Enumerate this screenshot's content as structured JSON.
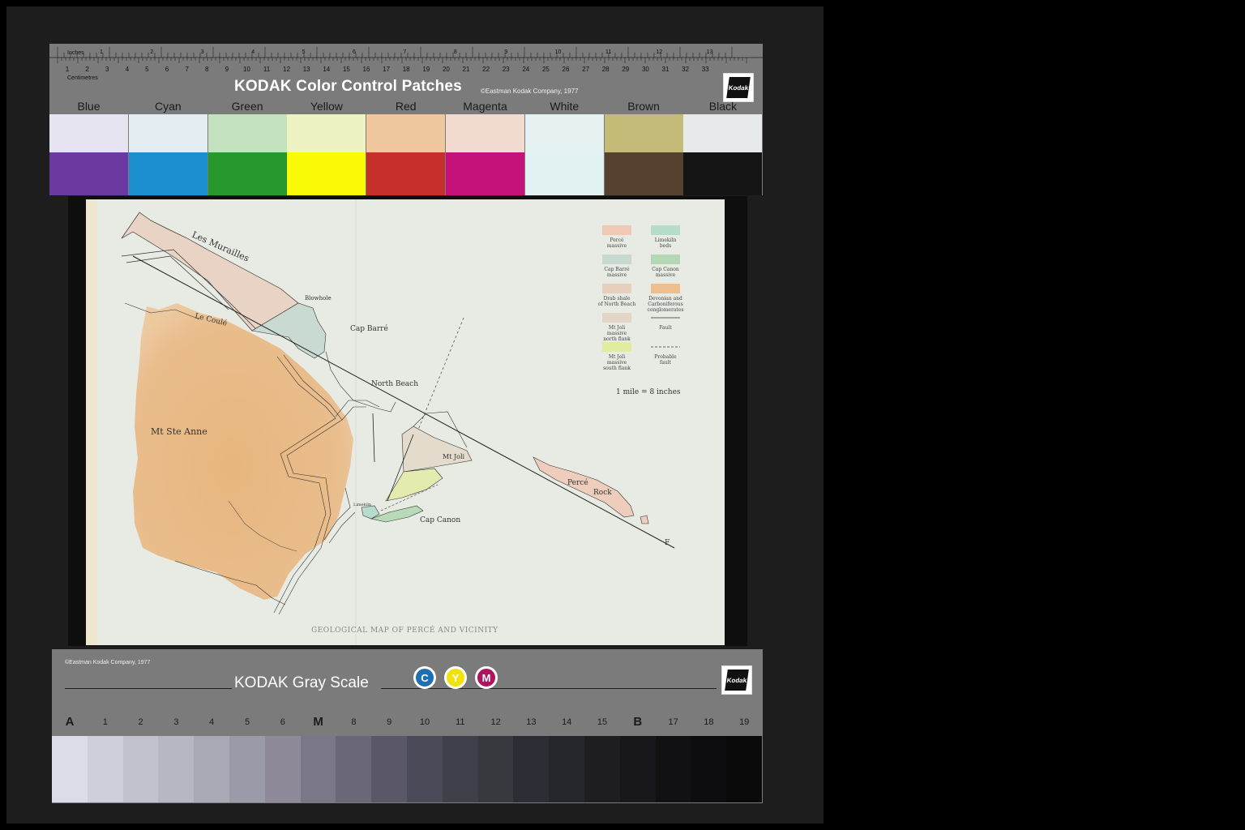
{
  "color_bar": {
    "ruler_inches_label": "Inches",
    "ruler_cm_label": "Centimetres",
    "inch_numbers": [
      "1",
      "2",
      "3",
      "4",
      "5",
      "6",
      "7",
      "8",
      "9",
      "10",
      "11",
      "12",
      "13"
    ],
    "cm_numbers": [
      "1",
      "2",
      "3",
      "4",
      "5",
      "6",
      "7",
      "8",
      "9",
      "10",
      "11",
      "12",
      "13",
      "14",
      "15",
      "16",
      "17",
      "18",
      "19",
      "20",
      "21",
      "22",
      "23",
      "24",
      "25",
      "26",
      "27",
      "28",
      "29",
      "30",
      "31",
      "32",
      "33"
    ],
    "title": "KODAK Color Control Patches",
    "copyright": "©Eastman Kodak Company, 1977",
    "logo_text": "Kodak",
    "patches": [
      {
        "label": "Blue",
        "light": "#e6e4f0",
        "dark": "#6a3aa0"
      },
      {
        "label": "Cyan",
        "light": "#e4eef2",
        "dark": "#1c8fd0"
      },
      {
        "label": "Green",
        "light": "#c4e2be",
        "dark": "#26982c"
      },
      {
        "label": "Yellow",
        "light": "#eff3c4",
        "dark": "#fafa06"
      },
      {
        "label": "Red",
        "light": "#f1c7a0",
        "dark": "#c6302a"
      },
      {
        "label": "Magenta",
        "light": "#f2dbd0",
        "dark": "#c4127a"
      },
      {
        "label": "White",
        "light": "#e6f2f2",
        "dark": "#e2f2f2"
      },
      {
        "label": "Brown",
        "light": "#c4bb78",
        "dark": "#56402e"
      },
      {
        "label": "Black",
        "light": "#e6eaea",
        "dark": "#151515"
      }
    ]
  },
  "map": {
    "caption": "GEOLOGICAL MAP OF PERCÉ AND VICINITY",
    "labels": {
      "les_murailles": "Les Murailles",
      "blowhole": "Blowhole",
      "le_coulé": "Le Coulé",
      "cap_barre": "Cap Barré",
      "north_beach": "North Beach",
      "mt_ste_anne": "Mt Ste Anne",
      "mt_joli": "Mt Joli",
      "perce_rock": "Percé",
      "rock": "Rock",
      "limekiln": "Limekiln",
      "cap_canon": "Cap Canon",
      "fault_marker": "F"
    },
    "legend": [
      {
        "label": [
          "Percé",
          "massive"
        ],
        "color": "#f0c8b6"
      },
      {
        "label": [
          "Limekiln",
          "beds"
        ],
        "color": "#b6dccb"
      },
      {
        "label": [
          "Cap Barré",
          "massive"
        ],
        "color": "#c6d8cf"
      },
      {
        "label": [
          "Cap Canon",
          "massive"
        ],
        "color": "#b4d8b6"
      },
      {
        "label": [
          "Drab shale",
          "of North Beach"
        ],
        "color": "#e6cfbc"
      },
      {
        "label": [
          "Devonian and",
          "Carboniferous",
          "conglomerates"
        ],
        "color": "#efbe8e"
      },
      {
        "label": [
          "Mt Joli",
          "massive",
          "north flank"
        ],
        "color": "#e3d6c7"
      },
      {
        "label": [
          "Fault"
        ],
        "color": "line"
      },
      {
        "label": [
          "Mt Joli",
          "massive",
          "south flank"
        ],
        "color": "#e2ec9e"
      },
      {
        "label": [
          "Probable",
          "fault"
        ],
        "color": "dashline"
      }
    ],
    "scale": "1 mile = 8 inches"
  },
  "gray_bar": {
    "copyright": "©Eastman Kodak Company, 1977",
    "title": "KODAK Gray Scale",
    "logo_text": "Kodak",
    "cmy": [
      {
        "letter": "C",
        "color": "#1e6fb4"
      },
      {
        "letter": "Y",
        "color": "#f2e20a"
      },
      {
        "letter": "M",
        "color": "#b0145e"
      }
    ],
    "steps": [
      "A",
      "1",
      "2",
      "3",
      "4",
      "5",
      "6",
      "M",
      "8",
      "9",
      "10",
      "11",
      "12",
      "13",
      "14",
      "15",
      "B",
      "17",
      "18",
      "19"
    ],
    "step_colors": [
      "#dcdce8",
      "#cfcfdc",
      "#c2c2cf",
      "#b7b7c3",
      "#a9a9b6",
      "#9a9aa8",
      "#8e8a9a",
      "#7a7888",
      "#6a6878",
      "#5a5868",
      "#4b4a58",
      "#40404a",
      "#38383f",
      "#2c2c34",
      "#25252c",
      "#1d1d22",
      "#18181c",
      "#111114",
      "#0d0d0f",
      "#0a0a0b"
    ]
  }
}
